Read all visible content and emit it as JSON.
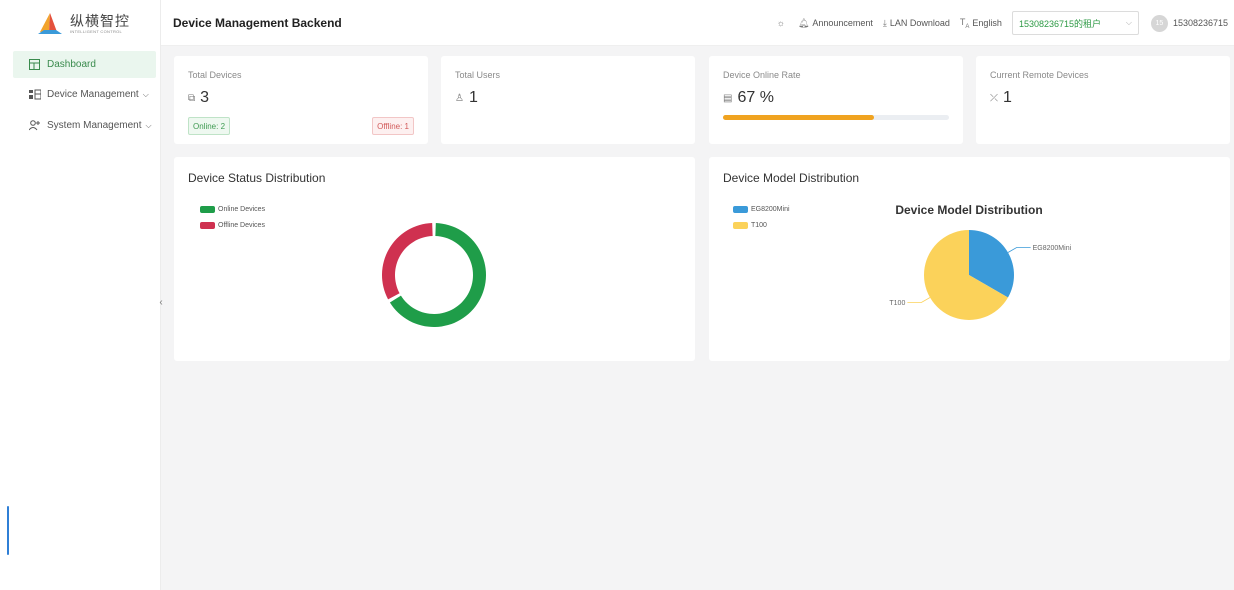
{
  "app": {
    "logo_cn": "纵横智控",
    "logo_en": "INTELLIGENT CONTROL",
    "page_title": "Device Management Backend"
  },
  "sidebar": {
    "items": [
      {
        "label": "Dashboard",
        "icon": "dashboard-icon",
        "active": true
      },
      {
        "label": "Device Management",
        "icon": "device-management-icon",
        "active": false
      },
      {
        "label": "System Management",
        "icon": "system-management-icon",
        "active": false
      }
    ]
  },
  "header": {
    "announcement": "Announcement",
    "lan_download": "LAN Download",
    "language": "English",
    "tenant": "15308236715的租户",
    "avatar_text": "15",
    "username": "15308236715"
  },
  "stats": {
    "total_devices": {
      "label": "Total Devices",
      "value": "3",
      "online": "Online: 2",
      "offline": "Offline: 1"
    },
    "total_users": {
      "label": "Total Users",
      "value": "1"
    },
    "online_rate": {
      "label": "Device Online Rate",
      "value": "67 %",
      "percent": 67
    },
    "remote_devices": {
      "label": "Current Remote Devices",
      "value": "1"
    }
  },
  "colors": {
    "online": "#1f9d49",
    "offline": "#cf3150",
    "eg8200": "#3a9ad9",
    "t100": "#fbd25a",
    "progress": "#f0a320"
  },
  "status_panel": {
    "title": "Device Status Distribution",
    "chart_data": {
      "type": "pie",
      "categories": [
        "Online Devices",
        "Offline Devices"
      ],
      "values": [
        2,
        1
      ]
    }
  },
  "model_panel": {
    "title": "Device Model Distribution",
    "chart_data": {
      "type": "pie",
      "title": "Device Model Distribution",
      "categories": [
        "EG8200Mini",
        "T100"
      ],
      "values": [
        1,
        2
      ]
    }
  }
}
